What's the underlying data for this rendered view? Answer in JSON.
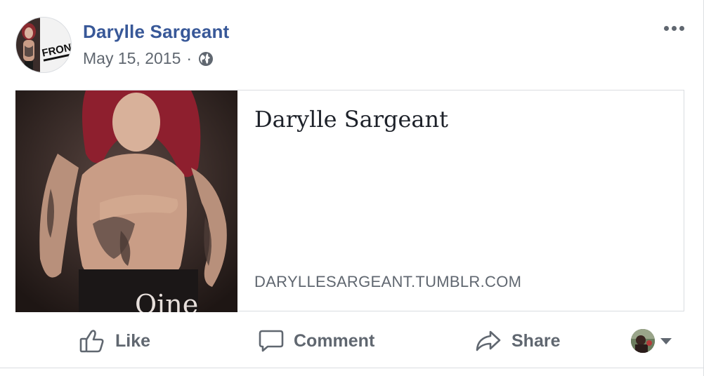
{
  "post": {
    "author": "Darylle Sargeant",
    "date": "May 15, 2015",
    "separator": "·",
    "privacy_icon": "globe-icon",
    "more_icon": "more-options-icon"
  },
  "link": {
    "title": "Darylle Sargeant",
    "domain": "DARYLLESARGEANT.TUMBLR.COM",
    "image_caption": "Oine"
  },
  "actions": {
    "like": "Like",
    "comment": "Comment",
    "share": "Share"
  },
  "avatar_text": "FRONT",
  "colors": {
    "author": "#385898",
    "meta": "#606770",
    "border": "#dadde1"
  }
}
